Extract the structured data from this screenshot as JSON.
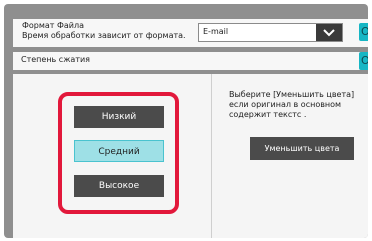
{
  "format": {
    "label_line1": "Формат Файла",
    "label_line2": "Время обработки зависит от формата.",
    "selected": "E-mail",
    "ok_label": "OK"
  },
  "compression": {
    "label": "Степень сжатия",
    "ok_label": "OK",
    "levels": [
      "Низкий",
      "Средний",
      "Высокое"
    ],
    "selected": "Средний"
  },
  "hint": {
    "line1": "Выберите [Уменьшить цвета]",
    "line2": "если оригинал в основном",
    "line3": "содержит текстс ."
  },
  "reduce_colors_button": "Уменьшить цвета",
  "colors": {
    "accent": "#17b6c4",
    "highlight": "#e2183b",
    "selected_level": "#9ee0e6"
  }
}
